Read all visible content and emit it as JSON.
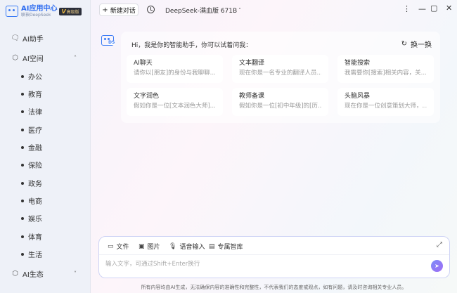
{
  "app": {
    "title": "AI应用中心",
    "subtitle": "联袂DeepSeek",
    "badge": "高级版"
  },
  "sidebar": {
    "assistant_label": "AI助手",
    "space_label": "AI空间",
    "items": [
      "办公",
      "教育",
      "法律",
      "医疗",
      "金融",
      "保险",
      "政务",
      "电商",
      "娱乐",
      "体育",
      "生活"
    ],
    "ecology_label": "AI生态"
  },
  "topbar": {
    "new_chat_label": "新建对话",
    "model_label": "DeepSeek-满血版 671B"
  },
  "chat": {
    "greeting": "Hi，我是你的智能助手，你可以试着问我：",
    "refresh_label": "换一换",
    "prompts": [
      {
        "title": "AI聊天",
        "desc": "请你以[朋友]的身份与我聊聊..."
      },
      {
        "title": "文本翻译",
        "desc": "现在你是一名专业的翻译人员..."
      },
      {
        "title": "智能搜索",
        "desc": "我需要你[搜索]相关内容，关..."
      },
      {
        "title": "文字润色",
        "desc": "假如你是一位[文本润色大师]..."
      },
      {
        "title": "教师备课",
        "desc": "假如你是一位[初中年级]的[历..."
      },
      {
        "title": "头脑风暴",
        "desc": "现在你是一位创意策划大师，..."
      }
    ]
  },
  "input": {
    "tools": [
      "文件",
      "图片",
      "语音输入",
      "专属智库"
    ],
    "placeholder": "输入文字，可通过Shift+Enter换行"
  },
  "footer": {
    "disclaimer": "所有内容均由AI生成，无法确保内容的准确性和完整性，不代表我们的态度或观点，如有问题，请及时咨询相关专业人员。"
  }
}
